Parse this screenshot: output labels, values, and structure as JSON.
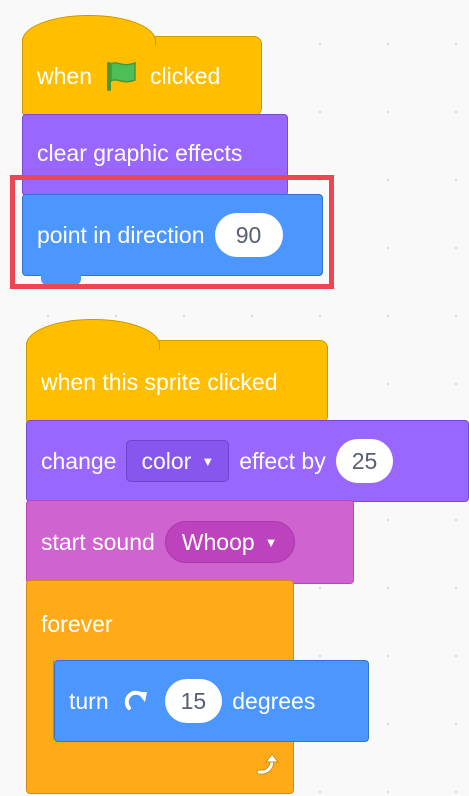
{
  "script1": {
    "hat": {
      "prefix": "when",
      "flag_icon": "green-flag-icon",
      "suffix": "clicked"
    },
    "clear": {
      "label": "clear graphic effects"
    },
    "point": {
      "label": "point in direction",
      "value": "90"
    }
  },
  "script2": {
    "hat": {
      "label": "when this sprite clicked"
    },
    "change": {
      "prefix": "change",
      "effect": "color",
      "middle": "effect by",
      "value": "25"
    },
    "sound": {
      "prefix": "start sound",
      "sound": "Whoop"
    },
    "forever": {
      "label": "forever",
      "repeat_icon": "loop-arrow-icon"
    },
    "turn": {
      "prefix": "turn",
      "icon": "rotate-clockwise-icon",
      "value": "15",
      "suffix": "degrees"
    }
  },
  "colors": {
    "events": "#ffbf00",
    "looks": "#9966ff",
    "motion": "#4c97ff",
    "sound": "#cf63cf",
    "control": "#ffab19",
    "highlight": "#ef4550"
  }
}
